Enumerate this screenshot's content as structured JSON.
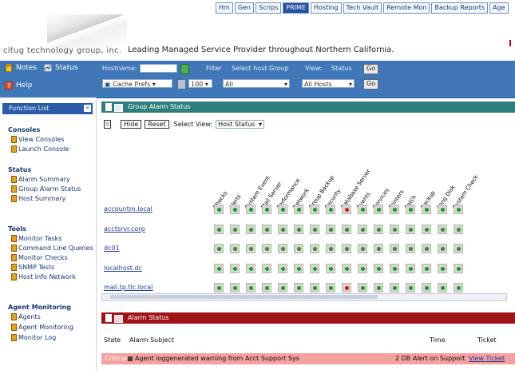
{
  "topnav": [
    "Hm",
    "Gen",
    "Scrips",
    "PRIME",
    "Hosting",
    "Tech Vault",
    "Remote Mon",
    "Backup Reports",
    "Age"
  ],
  "company": {
    "name": "citug technology group, inc.",
    "tagline": "Leading Managed Service Provider throughout Northern California."
  },
  "toolbar": {
    "btn_notes": "Notes",
    "btn_status": "Status",
    "btn_help": "Help",
    "lbl_hostname": "Hostname:",
    "lbl_filter": "Filter",
    "lbl_group": "Select host Group",
    "lbl_view": "View:",
    "lbl_status": "Status",
    "sel_sort": "Cache Prefs",
    "sel_num": "100",
    "sel_group": "All",
    "sel_state": "All Hosts",
    "btn_go": "Go",
    "btn_reset": "Go"
  },
  "sidebar": {
    "title": "Function List",
    "sections": [
      {
        "title": "Consoles",
        "items": [
          "View Consoles",
          "Launch Console"
        ]
      },
      {
        "title": "Status",
        "items": [
          "Alarm Summary",
          "Group Alarm Status",
          "Host Summary"
        ]
      },
      {
        "title": "Tools",
        "items": [
          "Monitor Tasks",
          "Command Line Queries",
          "Monitor Checks",
          "SNMP Tests",
          "Host Info Network"
        ]
      },
      {
        "title": "Agent Monitoring",
        "items": [
          "Agents",
          "Agent Monitoring",
          "Monitor Log"
        ]
      }
    ]
  },
  "panel": {
    "title": "Group Alarm Status",
    "btn_hide": "Hide",
    "btn_reset": "Reset",
    "lbl_select": "Select View:",
    "sel_view": "Host Status",
    "columns": [
      "Checks",
      "Alerts",
      "System Event",
      "Mail Server",
      "Performance",
      "Network",
      "Group Backup",
      "Security",
      "Database Server",
      "Events",
      "Services",
      "Printers",
      "Patch",
      "Backup",
      "Long Disk",
      "System Check"
    ],
    "rows": [
      {
        "host": "accountm.local",
        "status": [
          "g",
          "g",
          "g",
          "g",
          "g",
          "g",
          "g",
          "g",
          "r",
          "g",
          "g",
          "g",
          "g",
          "g",
          "g",
          "g"
        ]
      },
      {
        "host": "acctsrvr.corp",
        "status": [
          "g",
          "g",
          "g",
          "g",
          "g",
          "g",
          "g",
          "g",
          "g",
          "g",
          "g",
          "g",
          "g",
          "g",
          "g",
          "g"
        ]
      },
      {
        "host": "dc01",
        "status": [
          "g",
          "g",
          "g",
          "g",
          "g",
          "g",
          "g",
          "g",
          "g",
          "g",
          "g",
          "g",
          "g",
          "g",
          "g",
          "g"
        ]
      },
      {
        "host": "localhost.dc",
        "status": [
          "g",
          "g",
          "g",
          "g",
          "g",
          "g",
          "g",
          "g",
          "g",
          "g",
          "g",
          "g",
          "g",
          "g",
          "g",
          "g"
        ]
      },
      {
        "host": "mail.tp.tlc.local",
        "status": [
          "g",
          "g",
          "g",
          "g",
          "g",
          "g",
          "g",
          "g",
          "r",
          "g",
          "g",
          "g",
          "g",
          "g",
          "g",
          "g"
        ]
      }
    ]
  },
  "alarms": {
    "title": "Alarm Status",
    "head_state": "State",
    "head_subject": "Alarm Subject",
    "head_time": "Time",
    "head_ticket": "Ticket",
    "row_state": "Critical",
    "row_subject": "Agent loggenerated warning from Acct Support Sys",
    "row_time": "2 DB Alert on Support",
    "row_ticket": "View Ticket"
  }
}
